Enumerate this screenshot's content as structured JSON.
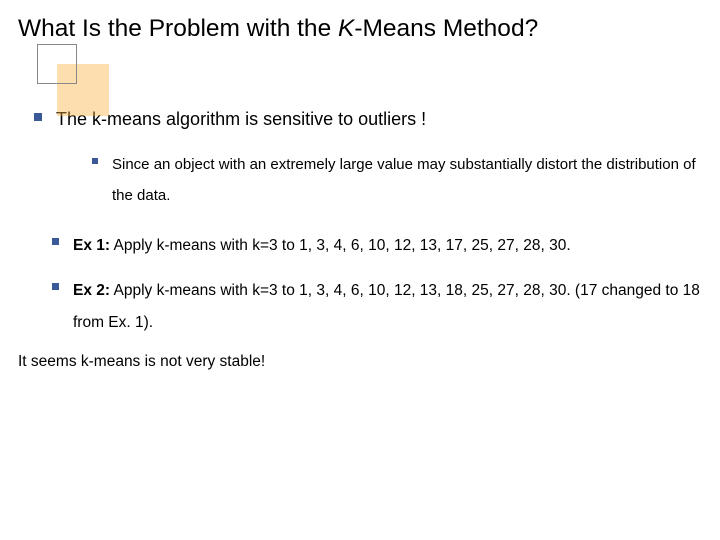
{
  "title": {
    "pre": "What Is the Problem with the ",
    "k": "K",
    "post": "-Means Method?"
  },
  "bullets": {
    "b1": "The k-means algorithm is sensitive to outliers !",
    "b2": "Since an object with an extremely large value may substantially distort the distribution of the data.",
    "ex1_label": "Ex 1:",
    "ex1_text": " Apply k-means with k=3 to 1, 3, 4, 6, 10, 12, 13, 17, 25, 27, 28, 30.",
    "ex2_label": "Ex 2:",
    "ex2_text": " Apply k-means with k=3 to 1, 3, 4, 6, 10, 12, 13, 18, 25, 27, 28, 30. (17 changed to 18 from Ex. 1)."
  },
  "conclusion": "It seems k-means is not very stable!"
}
